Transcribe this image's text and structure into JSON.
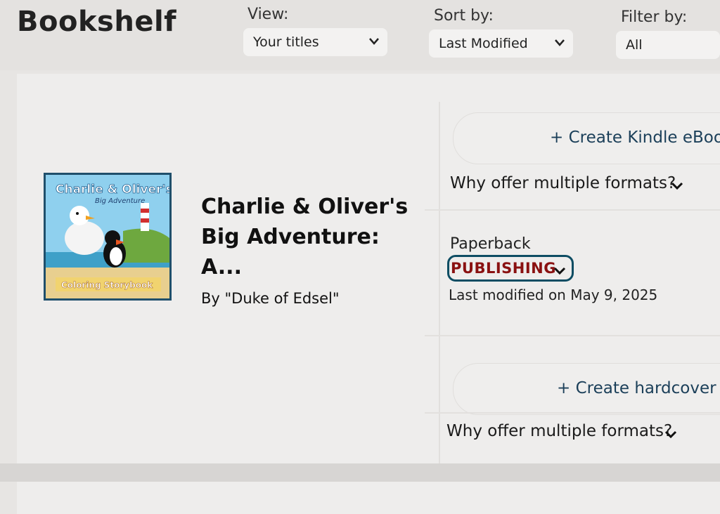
{
  "header": {
    "title": "Bookshelf",
    "view": {
      "label": "View:",
      "value": "Your titles"
    },
    "sort": {
      "label": "Sort by:",
      "value": "Last Modified"
    },
    "filter": {
      "label": "Filter by:",
      "value": "All"
    }
  },
  "book": {
    "title": "Charlie & Oliver's Big Adventure: A...",
    "author": "By \"Duke of Edsel\"",
    "cover_text": {
      "line1": "Charlie & Oliver's",
      "line2": "Big Adventure",
      "line3": "Coloring Storybook"
    }
  },
  "formats": {
    "kindle": {
      "create_label": "+ Create Kindle eBook",
      "why_label": "Why offer multiple formats?"
    },
    "paperback": {
      "label": "Paperback",
      "status": "PUBLISHING",
      "last_modified": "Last modified on May 9, 2025"
    },
    "hardcover": {
      "create_label": "+ Create hardcover",
      "why_label": "Why offer multiple formats?"
    }
  },
  "colors": {
    "status_text": "#8a1111",
    "status_border": "#0e4d63",
    "link": "#1b3f59"
  },
  "icons": [
    "chevron-down-icon",
    "book-cover-image"
  ]
}
